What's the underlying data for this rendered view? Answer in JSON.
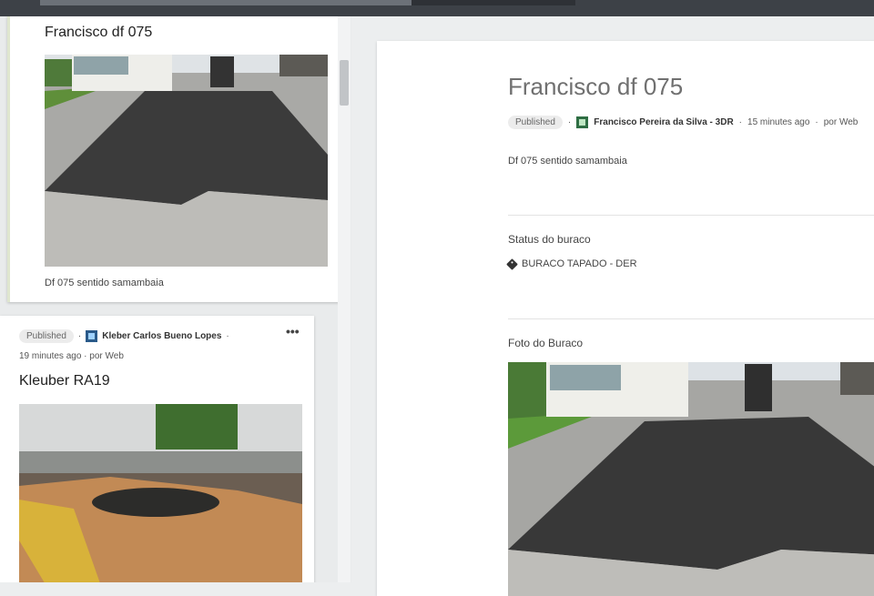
{
  "feed": {
    "card1": {
      "title": "Francisco df 075",
      "caption": "Df 075 sentido samambaia"
    },
    "card2": {
      "status": "Published",
      "author": "Kleber Carlos Bueno Lopes",
      "time": "19 minutes ago",
      "source": "por Web",
      "more": "•••",
      "title": "Kleuber RA19"
    }
  },
  "detail": {
    "title": "Francisco df 075",
    "status": "Published",
    "author": "Francisco Pereira da Silva - 3DR",
    "time": "15 minutes ago",
    "source": "por Web",
    "description": "Df 075 sentido samambaia",
    "status_section_label": "Status do buraco",
    "status_tag": "BURACO TAPADO - DER",
    "photo_section_label": "Foto do Buraco"
  },
  "icons": {
    "tag": "tag-icon",
    "avatar": "avatar-icon",
    "more": "more-options-icon"
  }
}
